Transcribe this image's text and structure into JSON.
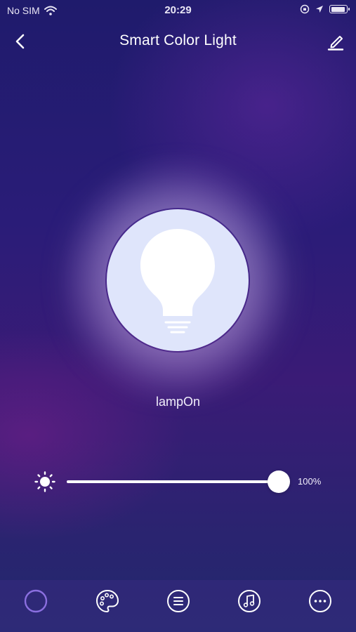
{
  "status_bar": {
    "carrier": "No SIM",
    "time": "20:29"
  },
  "nav": {
    "title": "Smart Color Light"
  },
  "lamp": {
    "status_text": "lampOn"
  },
  "brightness": {
    "value": 100,
    "label": "100%"
  },
  "tabs": [
    {
      "icon": "color-ring-icon",
      "active": true
    },
    {
      "icon": "palette-icon",
      "active": false
    },
    {
      "icon": "list-icon",
      "active": false
    },
    {
      "icon": "music-note-icon",
      "active": false
    },
    {
      "icon": "more-icon",
      "active": false
    }
  ],
  "colors": {
    "accent_active": "#8b6fe0",
    "bulb_fill": "#dfe5fb"
  }
}
